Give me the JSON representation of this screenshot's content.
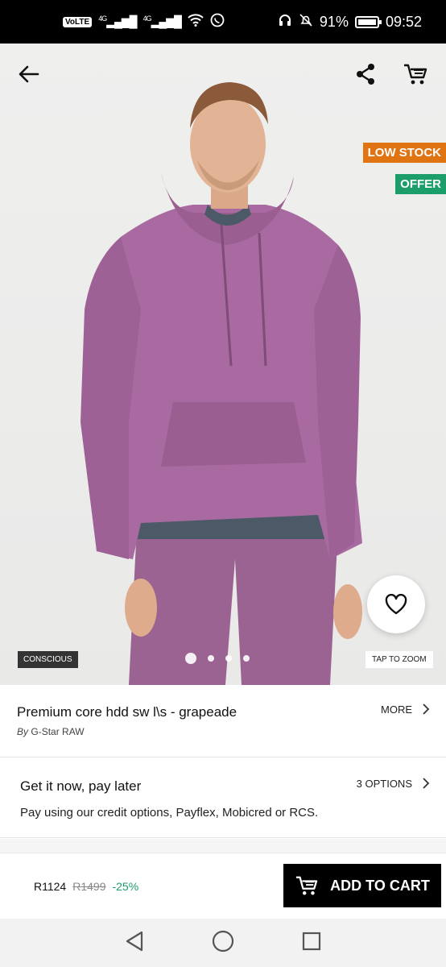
{
  "status_bar": {
    "volte": "VoLTE",
    "signal_1": "4G",
    "signal_2": "4G",
    "battery": "91%",
    "time": "09:52"
  },
  "hero": {
    "badges": {
      "low_stock": "LOW STOCK",
      "offer": "OFFER"
    },
    "conscious_label": "CONSCIOUS",
    "zoom_label": "TAP TO ZOOM",
    "carousel": {
      "current": 1,
      "total": 4
    },
    "icons": [
      "back-arrow-icon",
      "share-icon",
      "cart-icon",
      "heart-icon"
    ]
  },
  "product": {
    "title": "Premium core hdd sw l\\s - grapeade",
    "by_prefix": "By",
    "brand": "G-Star RAW",
    "more_label": "MORE"
  },
  "payment": {
    "title": "Get it now, pay later",
    "options_label": "3 OPTIONS",
    "description": "Pay using our credit options, Payflex, Mobicred or RCS."
  },
  "buy": {
    "price": "R1124",
    "was_price": "R1499",
    "discount": "-25%",
    "add_to_cart": "ADD TO CART"
  },
  "colors": {
    "low_stock": "#e07412",
    "offer": "#1c9e6b",
    "discount": "#1c9e6b",
    "hoodie": "#a86aa0"
  }
}
